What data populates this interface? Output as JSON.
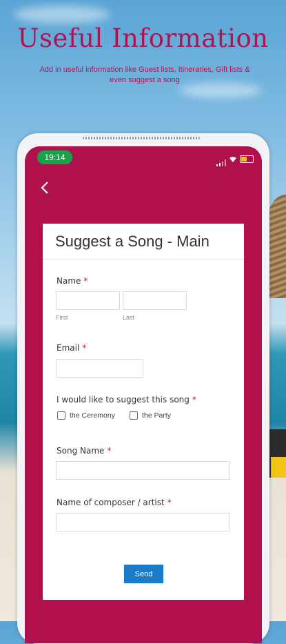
{
  "promo": {
    "headline": "Useful Information",
    "subline": "Add in useful information like Guest lists, Itineraries,  Gift lists & even suggest a song",
    "accent_color": "#b31250"
  },
  "status_bar": {
    "time": "19:14",
    "icons": [
      "signal-icon",
      "wifi-icon",
      "battery-icon"
    ]
  },
  "nav": {
    "back_icon": "chevron-left-icon"
  },
  "form": {
    "title": "Suggest a Song - Main",
    "name_label": "Name",
    "required_mark": "*",
    "first_sublabel": "First",
    "last_sublabel": "Last",
    "email_label": "Email",
    "suggest_label": "I would like to suggest this song",
    "options": [
      "the Ceremony",
      "the Party"
    ],
    "song_name_label": "Song Name",
    "composer_label": "Name of composer / artist",
    "send_label": "Send"
  },
  "colors": {
    "screen_bg": "#b0104b",
    "time_pill": "#16a34a",
    "send_button": "#1a7bc9",
    "required": "#c0183f"
  }
}
